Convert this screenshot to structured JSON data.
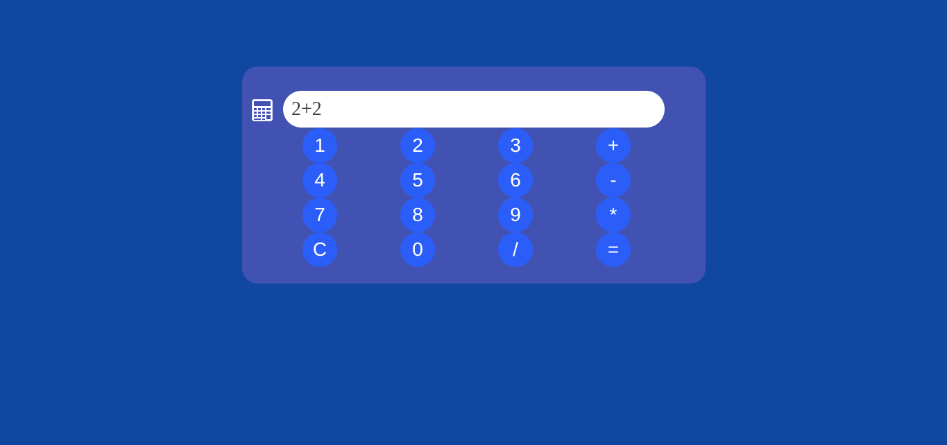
{
  "display": {
    "value": "2+2"
  },
  "icon": "calculator-icon",
  "keys": [
    "1",
    "2",
    "3",
    "+",
    "4",
    "5",
    "6",
    "-",
    "7",
    "8",
    "9",
    "*",
    "C",
    "0",
    "/",
    "="
  ],
  "colors": {
    "background": "#0f47a1",
    "panel": "#4152b3",
    "key": "#2b5ef8",
    "key_text": "#ffffff",
    "display": "#ffffff"
  }
}
